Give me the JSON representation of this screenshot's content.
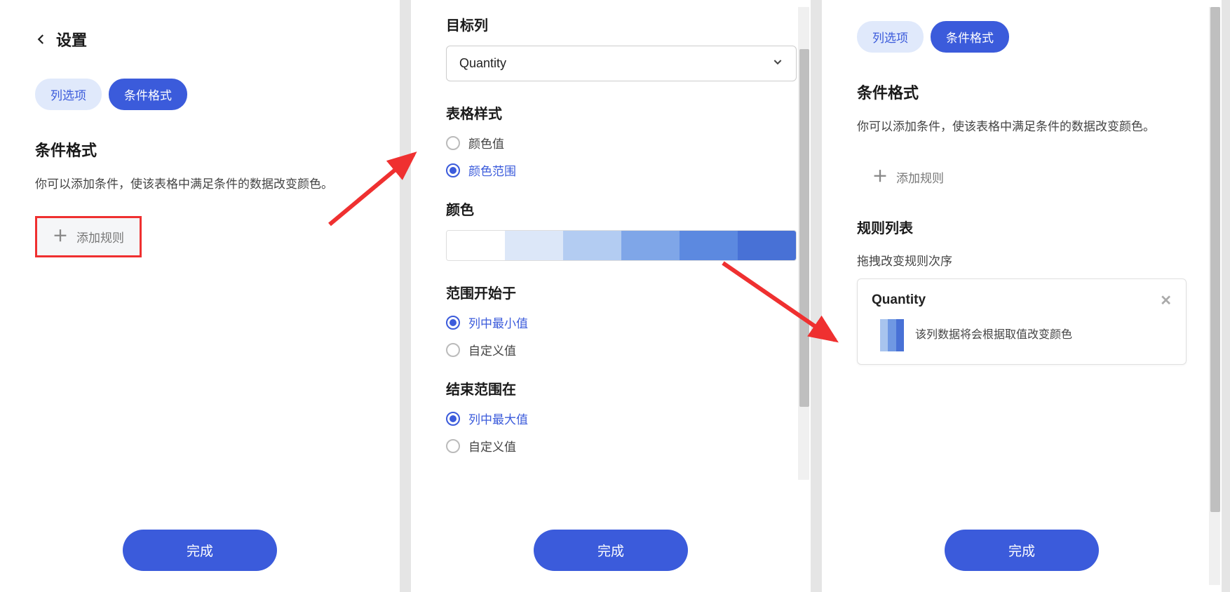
{
  "common": {
    "done_label": "完成",
    "tab_column_options": "列选项",
    "tab_conditional_format": "条件格式",
    "add_rule_label": "添加规则"
  },
  "panel1": {
    "header_title": "设置",
    "section_title": "条件格式",
    "section_desc": "你可以添加条件，使该表格中满足条件的数据改变颜色。"
  },
  "panel2": {
    "target_column_label": "目标列",
    "target_column_value": "Quantity",
    "table_style_label": "表格样式",
    "style_option_value": "颜色值",
    "style_option_range": "颜色范围",
    "color_label": "颜色",
    "gradient_colors": [
      "#ffffff",
      "#dce7f8",
      "#b3ccf2",
      "#7fa6e8",
      "#5c89e0",
      "#4871d6"
    ],
    "range_start_label": "范围开始于",
    "range_start_min": "列中最小值",
    "range_start_custom": "自定义值",
    "range_end_label": "结束范围在",
    "range_end_max": "列中最大值",
    "range_end_custom": "自定义值"
  },
  "panel3": {
    "section_title": "条件格式",
    "section_desc": "你可以添加条件，使该表格中满足条件的数据改变颜色。",
    "rule_list_label": "规则列表",
    "drag_hint": "拖拽改变规则次序",
    "rule": {
      "title": "Quantity",
      "desc": "该列数据将会根据取值改变颜色",
      "mini_colors": [
        "#ffffff",
        "#a8c4ee",
        "#6f98e3",
        "#4871d6"
      ]
    }
  }
}
